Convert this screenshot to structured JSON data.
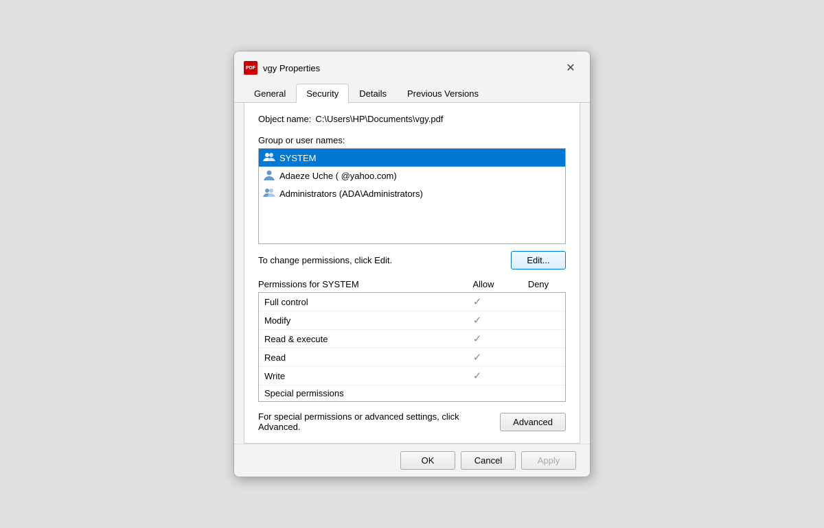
{
  "dialog": {
    "title": "vgy Properties",
    "pdf_icon_text": "PDF"
  },
  "tabs": [
    {
      "id": "general",
      "label": "General",
      "active": false
    },
    {
      "id": "security",
      "label": "Security",
      "active": true
    },
    {
      "id": "details",
      "label": "Details",
      "active": false
    },
    {
      "id": "previous-versions",
      "label": "Previous Versions",
      "active": false
    }
  ],
  "security": {
    "object_name_label": "Object name:",
    "object_path": "C:\\Users\\HP\\Documents\\vgy.pdf",
    "group_label": "Group or user names:",
    "users": [
      {
        "id": "system",
        "name": "SYSTEM",
        "selected": true
      },
      {
        "id": "adaeze",
        "name": "Adaeze Uche (              @yahoo.com)"
      },
      {
        "id": "administrators",
        "name": "Administrators (ADA\\Administrators)"
      }
    ],
    "edit_desc": "To change permissions, click Edit.",
    "edit_button": "Edit...",
    "permissions_label": "Permissions for SYSTEM",
    "allow_label": "Allow",
    "deny_label": "Deny",
    "permissions": [
      {
        "name": "Full control",
        "allow": true,
        "deny": false
      },
      {
        "name": "Modify",
        "allow": true,
        "deny": false
      },
      {
        "name": "Read & execute",
        "allow": true,
        "deny": false
      },
      {
        "name": "Read",
        "allow": true,
        "deny": false
      },
      {
        "name": "Write",
        "allow": true,
        "deny": false
      },
      {
        "name": "Special permissions",
        "allow": false,
        "deny": false
      }
    ],
    "advanced_desc": "For special permissions or advanced settings, click Advanced.",
    "advanced_button": "Advanced"
  },
  "footer": {
    "ok_label": "OK",
    "cancel_label": "Cancel",
    "apply_label": "Apply"
  }
}
